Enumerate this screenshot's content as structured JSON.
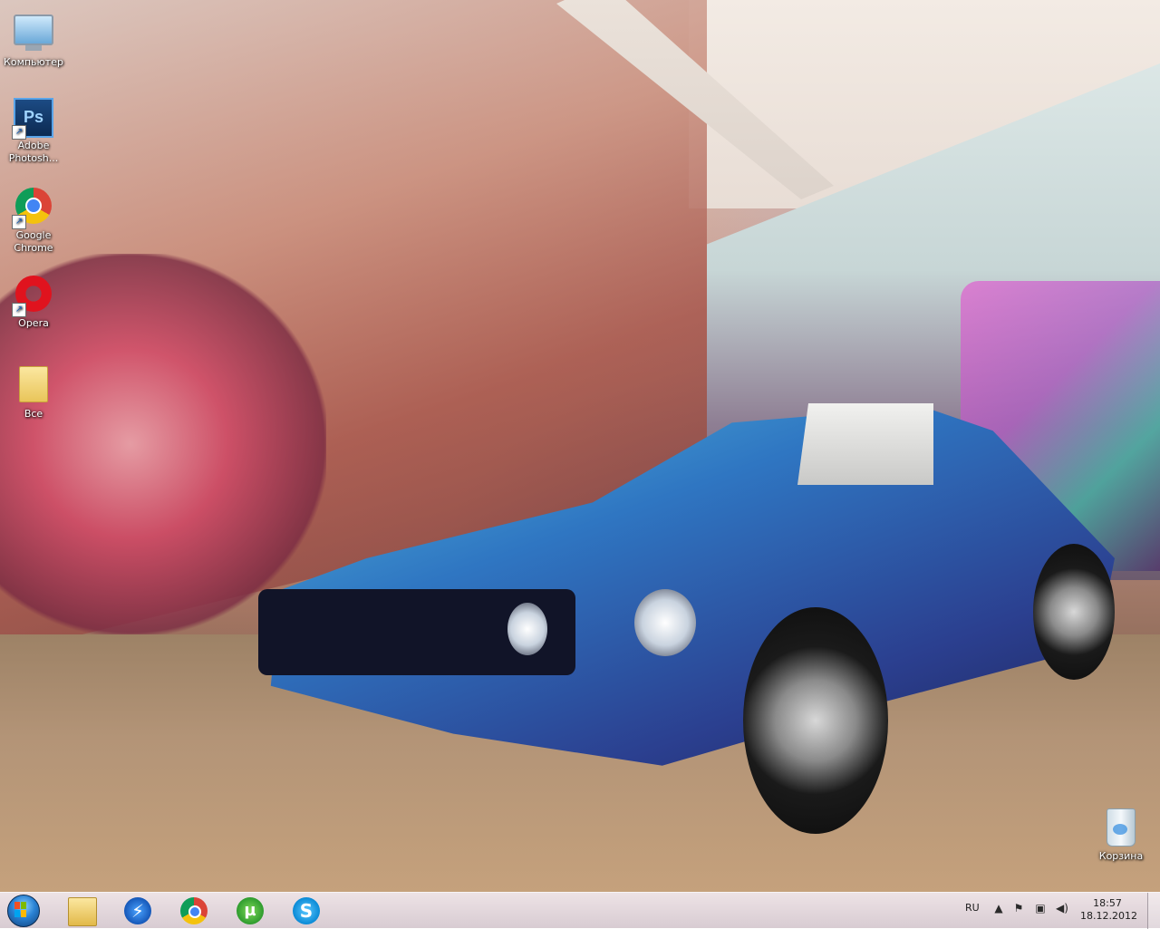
{
  "desktop": {
    "icons": [
      {
        "label": "Компьютер",
        "icon": "computer-icon",
        "shortcut": false
      },
      {
        "label": "Adobe Photosh...",
        "icon": "photoshop-icon",
        "shortcut": true,
        "glyph_text": "Ps"
      },
      {
        "label": "Google Chrome",
        "icon": "chrome-icon",
        "shortcut": true
      },
      {
        "label": "Opera",
        "icon": "opera-icon",
        "shortcut": true
      },
      {
        "label": "Все",
        "icon": "folder-icon",
        "shortcut": false
      }
    ],
    "recycle_bin": {
      "label": "Корзина",
      "icon": "recycle-bin-icon"
    }
  },
  "taskbar": {
    "start": {
      "icon": "windows-start-orb-icon"
    },
    "pinned": [
      {
        "name": "windows-explorer",
        "icon": "folder-icon"
      },
      {
        "name": "thunder",
        "icon": "lightning-icon",
        "glyph_text": "⚡"
      },
      {
        "name": "google-chrome",
        "icon": "chrome-icon"
      },
      {
        "name": "utorrent",
        "icon": "utorrent-icon",
        "glyph_text": "µ"
      },
      {
        "name": "skype",
        "icon": "skype-icon",
        "glyph_text": "S"
      }
    ],
    "tray": {
      "language": "RU",
      "icons": [
        "chevron-up-icon",
        "action-center-flag-icon",
        "network-icon",
        "volume-icon"
      ],
      "time": "18:57",
      "date": "18.12.2012"
    }
  },
  "colors": {
    "taskbar": "#e3d6db",
    "start_orb": "#2a82d4",
    "opera_red": "#e0131e"
  }
}
